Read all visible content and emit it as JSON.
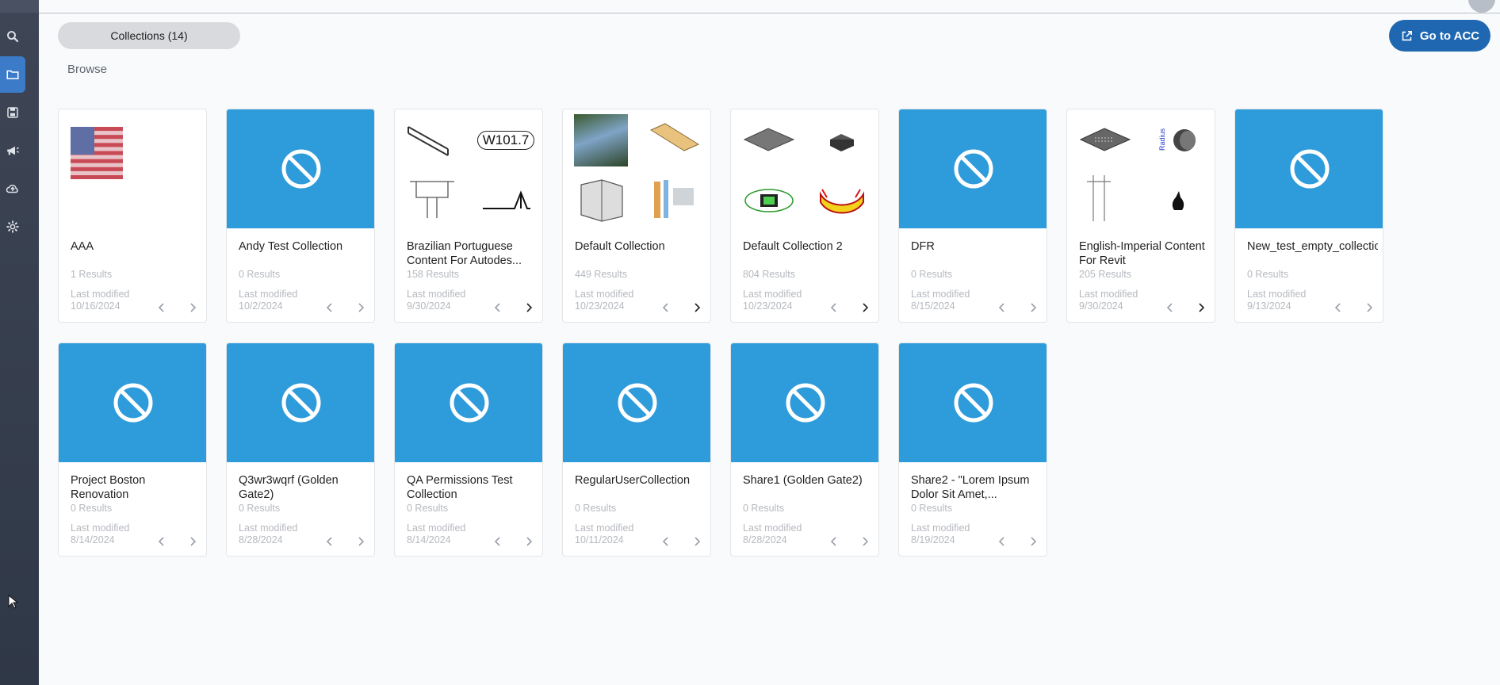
{
  "header": {
    "collections_tab": "Collections (14)",
    "browse_label": "Browse",
    "go_to_acc_label": "Go to ACC"
  },
  "sidebar": {
    "items": [
      {
        "icon": "search-icon"
      },
      {
        "icon": "folder-icon",
        "active": true
      },
      {
        "icon": "save-icon"
      },
      {
        "icon": "megaphone-icon"
      },
      {
        "icon": "cloud-upload-icon"
      },
      {
        "icon": "gear-icon"
      }
    ]
  },
  "colors": {
    "accent": "#1f67b1",
    "thumb_placeholder": "#2e9bdb",
    "sidebar": "#343c4b"
  },
  "collections": [
    {
      "title": "AAA",
      "results": "1 Results",
      "last_modified_label": "Last modified",
      "date": "10/16/2024",
      "thumb": "flag",
      "next_enabled": false
    },
    {
      "title": "Andy Test Collection",
      "results": "0 Results",
      "last_modified_label": "Last modified",
      "date": "10/2/2024",
      "thumb": "none",
      "next_enabled": false
    },
    {
      "title": "Brazilian Portuguese Content For Autodes...",
      "results": "158 Results",
      "last_modified_label": "Last modified",
      "date": "9/30/2024",
      "thumb": "grid",
      "next_enabled": true,
      "thumb_text": "W101.7"
    },
    {
      "title": "Default Collection",
      "results": "449 Results",
      "last_modified_label": "Last modified",
      "date": "10/23/2024",
      "thumb": "grid",
      "next_enabled": true
    },
    {
      "title": "Default Collection 2",
      "results": "804 Results",
      "last_modified_label": "Last modified",
      "date": "10/23/2024",
      "thumb": "grid",
      "next_enabled": true
    },
    {
      "title": "DFR",
      "results": "0 Results",
      "last_modified_label": "Last modified",
      "date": "8/15/2024",
      "thumb": "none",
      "next_enabled": false
    },
    {
      "title": "English-Imperial Content For Revit",
      "results": "205 Results",
      "last_modified_label": "Last modified",
      "date": "9/30/2024",
      "thumb": "grid",
      "next_enabled": true,
      "thumb_text": "Radius"
    },
    {
      "title": "New_test_empty_collection",
      "results": "0 Results",
      "last_modified_label": "Last modified",
      "date": "9/13/2024",
      "thumb": "none",
      "next_enabled": false
    },
    {
      "title": "Project Boston Renovation",
      "results": "0 Results",
      "last_modified_label": "Last modified",
      "date": "8/14/2024",
      "thumb": "none",
      "next_enabled": false
    },
    {
      "title": "Q3wr3wqrf (Golden Gate2)",
      "results": "0 Results",
      "last_modified_label": "Last modified",
      "date": "8/28/2024",
      "thumb": "none",
      "next_enabled": false
    },
    {
      "title": "QA Permissions Test Collection",
      "results": "0 Results",
      "last_modified_label": "Last modified",
      "date": "8/14/2024",
      "thumb": "none",
      "next_enabled": false
    },
    {
      "title": "RegularUserCollection",
      "results": "0 Results",
      "last_modified_label": "Last modified",
      "date": "10/11/2024",
      "thumb": "none",
      "next_enabled": false
    },
    {
      "title": "Share1 (Golden Gate2)",
      "results": "0 Results",
      "last_modified_label": "Last modified",
      "date": "8/28/2024",
      "thumb": "none",
      "next_enabled": false
    },
    {
      "title": "Share2 - \"Lorem Ipsum Dolor Sit Amet,...",
      "results": "0 Results",
      "last_modified_label": "Last modified",
      "date": "8/19/2024",
      "thumb": "none",
      "next_enabled": false
    }
  ]
}
